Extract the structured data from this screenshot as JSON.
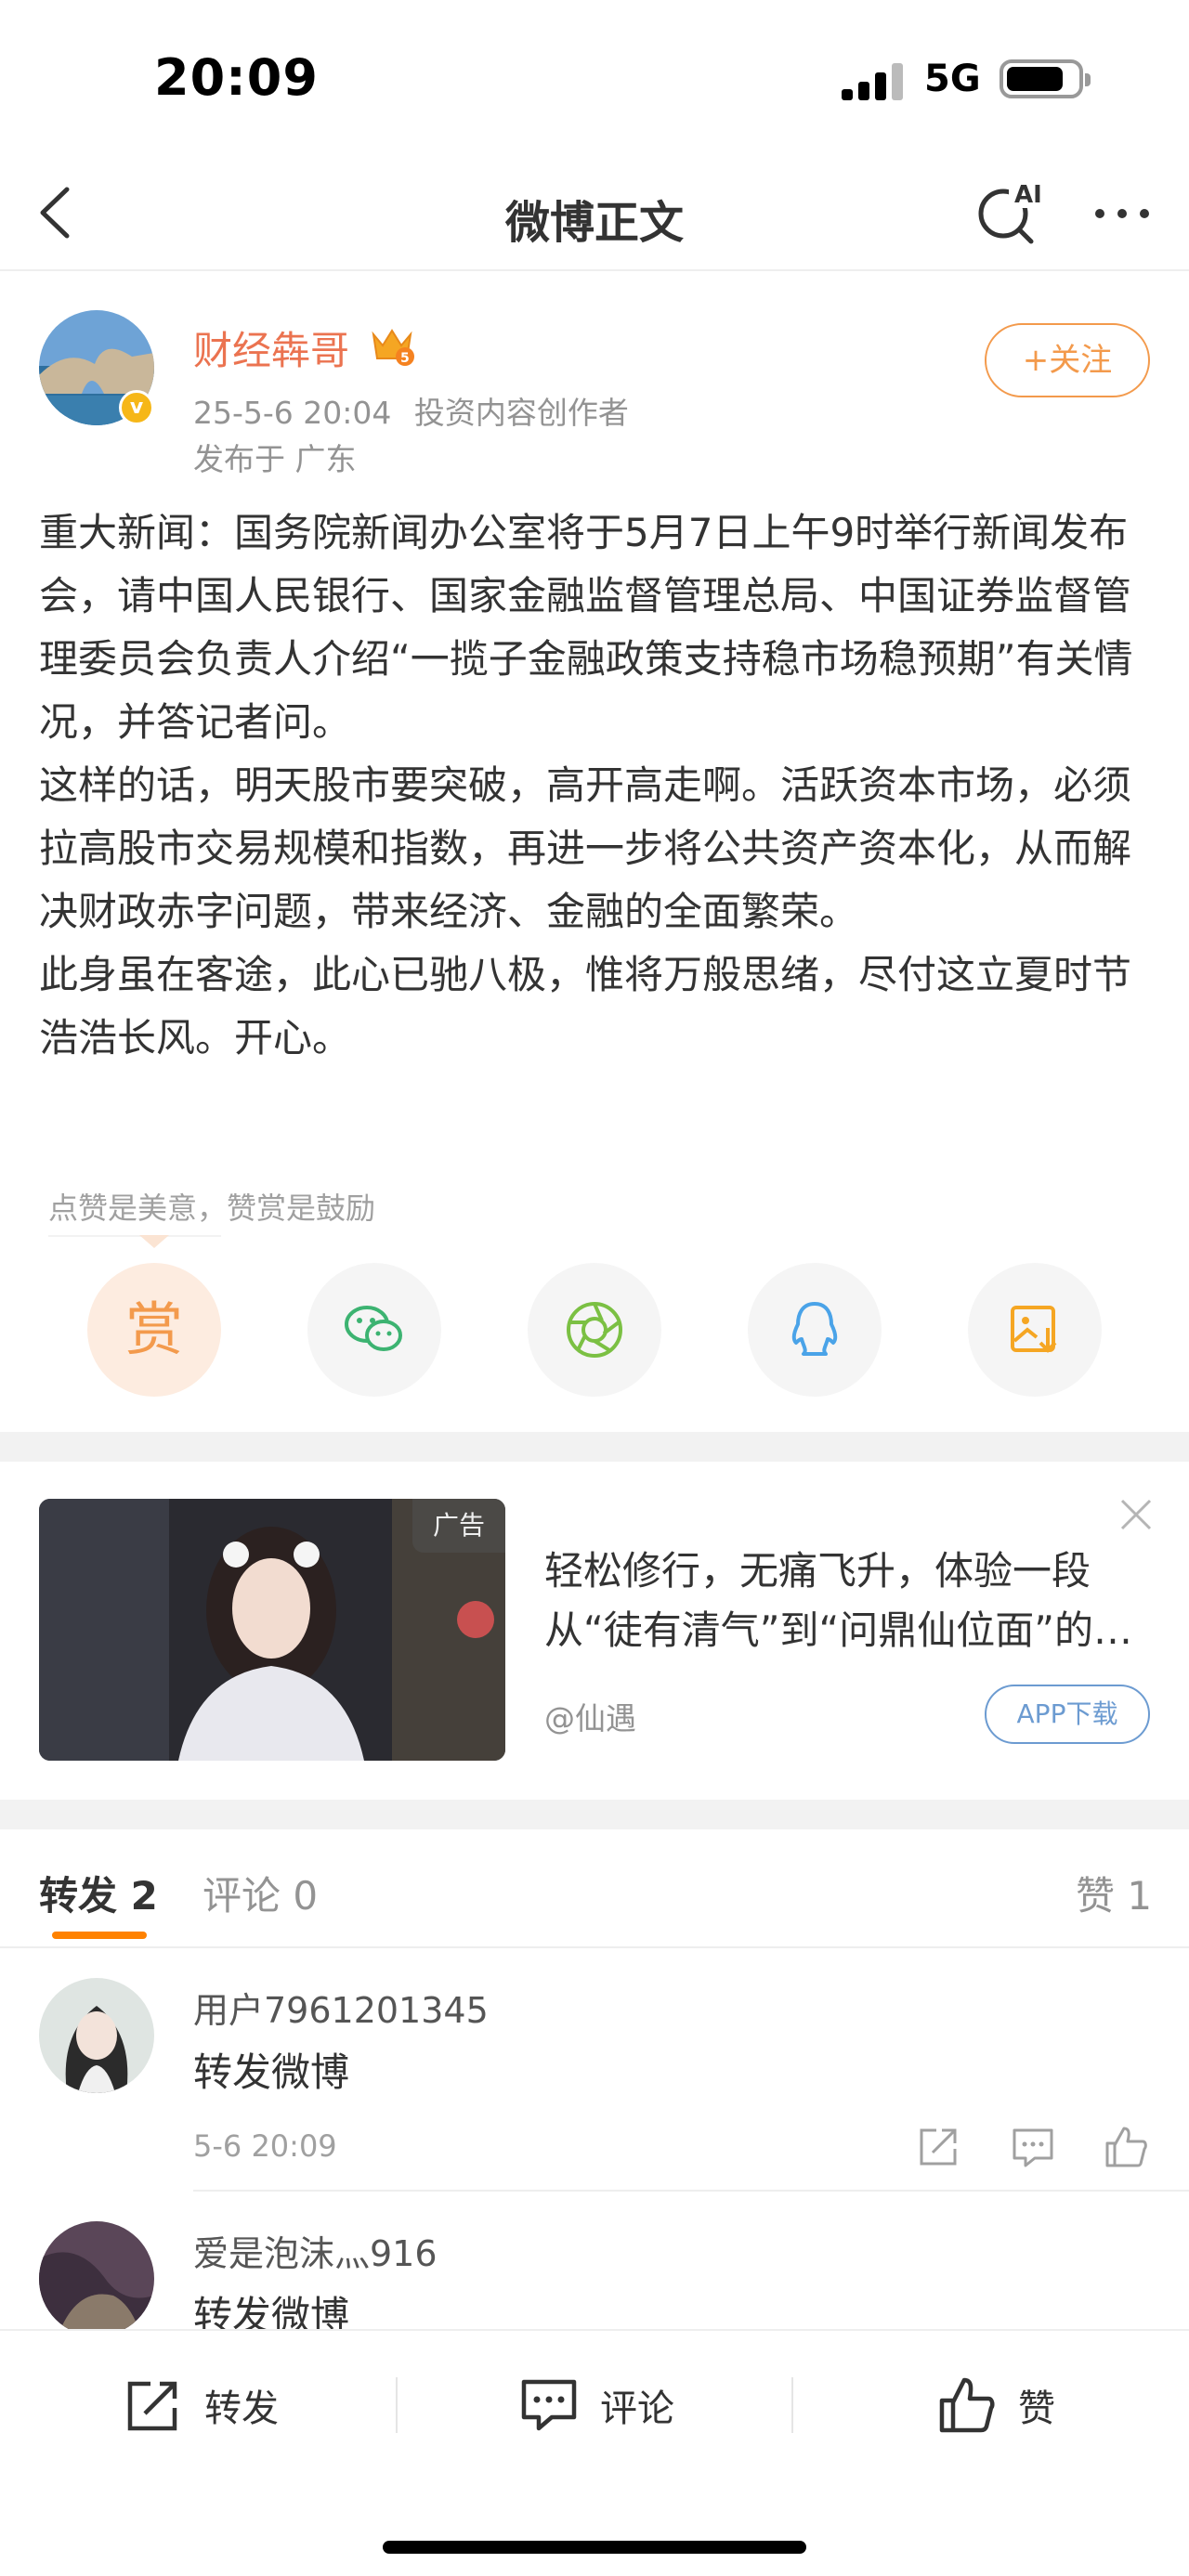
{
  "status": {
    "time": "20:09",
    "network": "5G"
  },
  "nav": {
    "title": "微博正文"
  },
  "post": {
    "author": "财经犇哥",
    "member_level": "5",
    "time": "25-5-6 20:04",
    "tag": "投资内容创作者",
    "location": "发布于 广东",
    "follow_label": "+关注",
    "paragraphs": [
      "重大新闻：国务院新闻办公室将于5月7日上午9时举行新闻发布会，请中国人民银行、国家金融监督管理总局、中国证券监督管理委员会负责人介绍“一揽子金融政策支持稳市场稳预期”有关情况，并答记者问。",
      "这样的话，明天股市要突破，高开高走啊。活跃资本市场，必须拉高股市交易规模和指数，再进一步将公共资产资本化，从而解决财政赤字问题，带来经济、金融的全面繁荣。",
      "此身虽在客途，此心已驰八极，惟将万般思绪，尽付这立夏时节浩浩长风。开心。"
    ],
    "reward_tip": "点赞是美意，赞赏是鼓励",
    "reward_label": "赏"
  },
  "share_icons": [
    "reward-icon",
    "wechat-icon",
    "moments-icon",
    "qq-icon",
    "save-image-icon"
  ],
  "ad": {
    "tag": "广告",
    "line1": "轻松修行，无痛飞升，体验一段",
    "line2": "从“徒有清气”到“问鼎仙位面”的…",
    "source": "@仙遇",
    "button": "APP下载"
  },
  "tabs": {
    "repost": "转发 2",
    "comment": "评论 0",
    "like": "赞 1"
  },
  "reposts": [
    {
      "user": "用户7961201345",
      "text": "转发微博",
      "time": "5-6 20:09"
    },
    {
      "user": "爱是泡沫灬916",
      "text": "转发微博"
    }
  ],
  "bottom_bar": {
    "repost": "转发",
    "comment": "评论",
    "like": "赞"
  },
  "colors": {
    "accent_orange": "#ff8200",
    "author_name": "#eb7350",
    "follow": "#f39a4c",
    "ad_button": "#6c9bd1"
  }
}
